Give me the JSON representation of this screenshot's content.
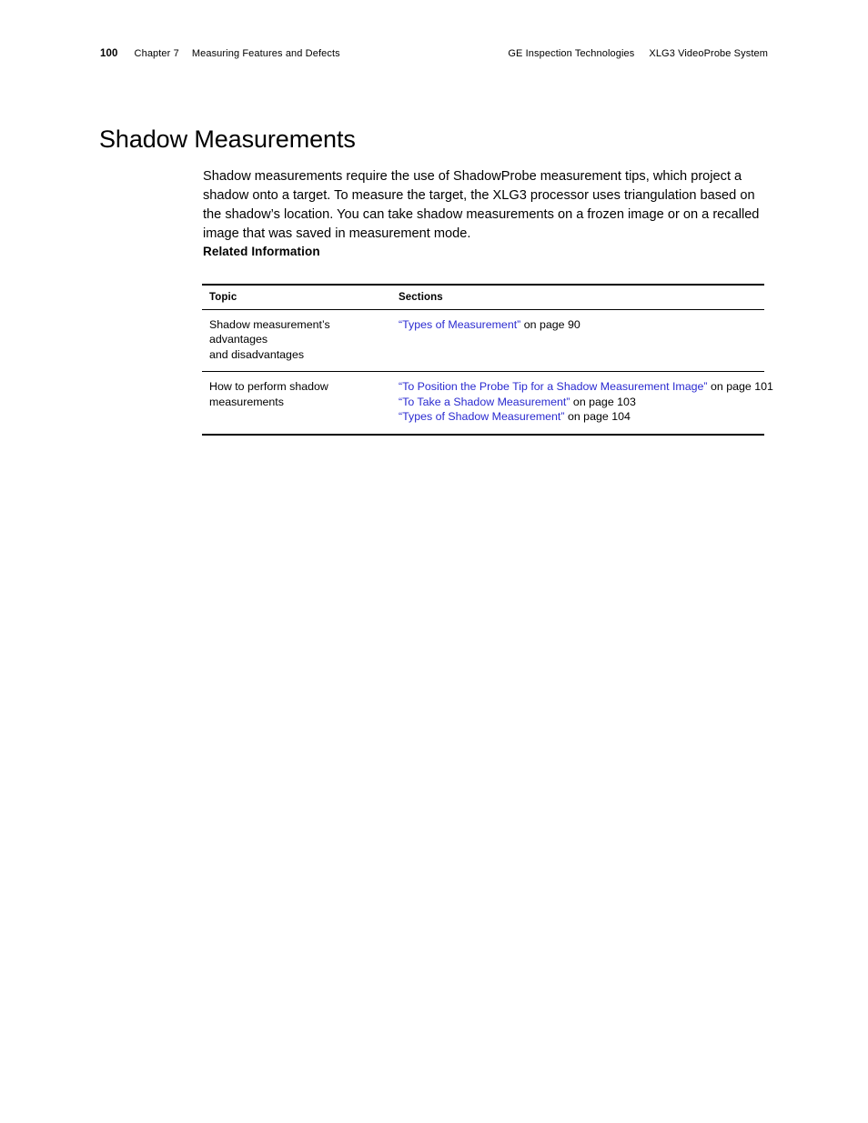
{
  "header": {
    "page_number": "100",
    "chapter_label": "Chapter 7",
    "chapter_title": "Measuring Features and Defects",
    "company": "GE Inspection Technologies",
    "product": "XLG3 VideoProbe System"
  },
  "title": "Shadow Measurements",
  "intro_paragraph": "Shadow measurements require the use of ShadowProbe measurement tips, which project a shadow onto a target. To measure the target, the XLG3 processor uses triangulation based on the shadow’s location. You can take shadow measurements on a frozen image or on a recalled image that was saved in measurement mode.",
  "related_information": {
    "heading": "Related Information",
    "columns": {
      "topic": "Topic",
      "sections": "Sections"
    },
    "rows": [
      {
        "topic_line_1": "Shadow measurement’s advantages",
        "topic_line_2": "and disadvantages",
        "sections": [
          {
            "link": "“Types of Measurement”",
            "suffix": " on page 90"
          }
        ]
      },
      {
        "topic_line_1": "How to perform shadow",
        "topic_line_2": "measurements",
        "sections": [
          {
            "link": "“To Position the Probe Tip for a Shadow Measurement Image”",
            "suffix": " on page 101"
          },
          {
            "link": "“To Take a Shadow Measurement”",
            "suffix": " on page 103"
          },
          {
            "link": "“Types of Shadow Measurement”",
            "suffix": " on page 104"
          }
        ]
      }
    ]
  },
  "colors": {
    "link": "#2a2ad0",
    "text": "#000000",
    "rule": "#000000",
    "background": "#ffffff"
  }
}
